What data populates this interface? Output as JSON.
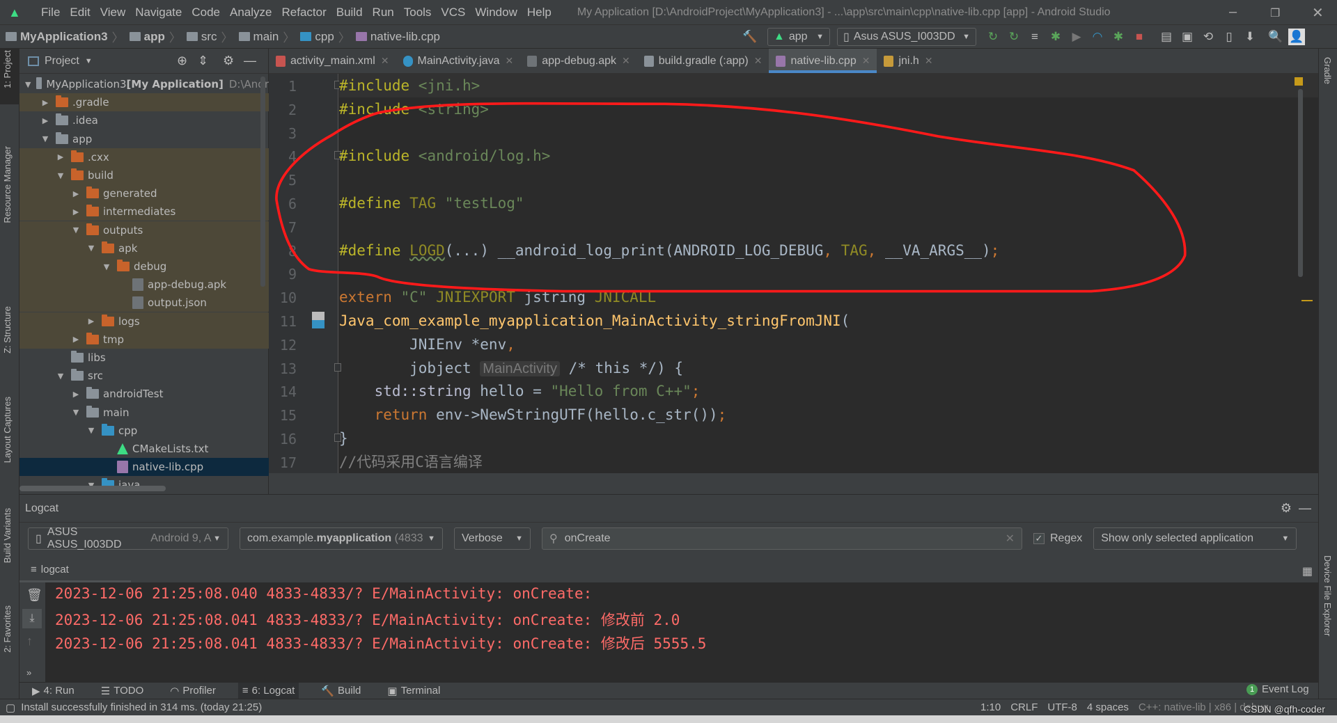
{
  "app": {
    "title": "My Application [D:\\AndroidProject\\MyApplication3] - ...\\app\\src\\main\\cpp\\native-lib.cpp [app] - Android Studio"
  },
  "menu": [
    "File",
    "Edit",
    "View",
    "Navigate",
    "Code",
    "Analyze",
    "Refactor",
    "Build",
    "Run",
    "Tools",
    "VCS",
    "Window",
    "Help"
  ],
  "breadcrumb": [
    "MyApplication3",
    "app",
    "src",
    "main",
    "cpp",
    "native-lib.cpp"
  ],
  "toolbar": {
    "run_config": "app",
    "device": "Asus ASUS_I003DD"
  },
  "left_strip": [
    "1: Project",
    "Resource Manager",
    "Z: Structure",
    "Layout Captures",
    "Build Variants",
    "2: Favorites"
  ],
  "right_strip": [
    "Gradle",
    "Device File Explorer"
  ],
  "project": {
    "header": "Project",
    "tree": [
      {
        "label": "MyApplication3",
        "extra": " [My Application]",
        "path": "D:\\Andr",
        "level": 0,
        "open": true,
        "icon": "module",
        "style": ""
      },
      {
        "label": ".gradle",
        "level": 1,
        "open": false,
        "icon": "folder-orange",
        "style": "excl"
      },
      {
        "label": ".idea",
        "level": 1,
        "open": false,
        "icon": "folder",
        "style": ""
      },
      {
        "label": "app",
        "level": 1,
        "open": true,
        "icon": "folder-module",
        "style": ""
      },
      {
        "label": ".cxx",
        "level": 2,
        "open": false,
        "icon": "folder-orange",
        "style": "excl"
      },
      {
        "label": "build",
        "level": 2,
        "open": true,
        "icon": "folder-orange",
        "style": "excl"
      },
      {
        "label": "generated",
        "level": 3,
        "open": false,
        "icon": "folder-orange",
        "style": "excl"
      },
      {
        "label": "intermediates",
        "level": 3,
        "open": false,
        "icon": "folder-orange",
        "style": "excl"
      },
      {
        "label": "outputs",
        "level": 3,
        "open": true,
        "icon": "folder-orange",
        "style": "excl"
      },
      {
        "label": "apk",
        "level": 4,
        "open": true,
        "icon": "folder-orange",
        "style": "excl"
      },
      {
        "label": "debug",
        "level": 5,
        "open": true,
        "icon": "folder-orange",
        "style": "excl"
      },
      {
        "label": "app-debug.apk",
        "level": 6,
        "icon": "apk-file",
        "style": "excl"
      },
      {
        "label": "output.json",
        "level": 6,
        "icon": "json-file",
        "style": "excl"
      },
      {
        "label": "logs",
        "level": 4,
        "open": false,
        "icon": "folder-orange",
        "style": "excl"
      },
      {
        "label": "tmp",
        "level": 3,
        "open": false,
        "icon": "folder-orange",
        "style": "excl"
      },
      {
        "label": "libs",
        "level": 2,
        "icon": "folder",
        "style": ""
      },
      {
        "label": "src",
        "level": 2,
        "open": true,
        "icon": "folder",
        "style": ""
      },
      {
        "label": "androidTest",
        "level": 3,
        "open": false,
        "icon": "folder",
        "style": ""
      },
      {
        "label": "main",
        "level": 3,
        "open": true,
        "icon": "folder",
        "style": ""
      },
      {
        "label": "cpp",
        "level": 4,
        "open": true,
        "icon": "folder-blue",
        "style": ""
      },
      {
        "label": "CMakeLists.txt",
        "level": 5,
        "icon": "cmake-file",
        "style": ""
      },
      {
        "label": "native-lib.cpp",
        "level": 5,
        "icon": "cpp-file",
        "style": "sel"
      },
      {
        "label": "java",
        "level": 4,
        "open": true,
        "icon": "folder-blue",
        "style": ""
      }
    ]
  },
  "tabs": [
    {
      "label": "activity_main.xml",
      "icon": "xml-file",
      "color": "#c75450"
    },
    {
      "label": "MainActivity.java",
      "icon": "java-class",
      "color": "#3592c4"
    },
    {
      "label": "app-debug.apk",
      "icon": "apk-file",
      "color": "#6e7377"
    },
    {
      "label": "build.gradle (:app)",
      "icon": "gradle",
      "color": "#8a9299"
    },
    {
      "label": "native-lib.cpp",
      "icon": "cpp-file",
      "color": "#9876aa",
      "active": true
    },
    {
      "label": "jni.h",
      "icon": "header-file",
      "color": "#c69a3a"
    }
  ],
  "code": [
    [
      [
        "#include",
        "pre"
      ],
      [
        " <jni.h>",
        "hdr"
      ]
    ],
    [
      [
        "#include",
        "pre"
      ],
      [
        " <string>",
        "hdr"
      ]
    ],
    [],
    [
      [
        "#include",
        "pre"
      ],
      [
        " <android/log.h>",
        "hdr"
      ]
    ],
    [],
    [
      [
        "#define",
        "pre"
      ],
      [
        " TAG ",
        "mac"
      ],
      [
        "\"testLog\"",
        "str"
      ]
    ],
    [],
    [
      [
        "#define",
        "pre"
      ],
      [
        " ",
        "txt"
      ],
      [
        "LOGD",
        "mac und"
      ],
      [
        "(...) __android_log_print(ANDROID_LOG_DEBUG",
        "txt"
      ],
      [
        ", ",
        "kw"
      ],
      [
        "TAG",
        "mac"
      ],
      [
        ", ",
        "kw"
      ],
      [
        "__VA_ARGS__)",
        "txt"
      ],
      [
        ";",
        "kw"
      ]
    ],
    [],
    [
      [
        "extern ",
        "kw"
      ],
      [
        "\"C\" ",
        "str"
      ],
      [
        "JNIEXPORT ",
        "mac"
      ],
      [
        "jstring ",
        "txt"
      ],
      [
        "JNICALL",
        "mac"
      ]
    ],
    [
      [
        "Java_com_example_myapplication_MainActivity_stringFromJNI",
        "fn"
      ],
      [
        "(",
        "txt"
      ]
    ],
    [
      [
        "        JNIEnv *env",
        "txt"
      ],
      [
        ",",
        "kw"
      ]
    ],
    [
      [
        "        jobject ",
        "txt"
      ],
      [
        "MainActivity",
        "hint"
      ],
      [
        " /* this */) {",
        "txt"
      ]
    ],
    [
      [
        "    ",
        "txt"
      ],
      [
        "std::string",
        "typ"
      ],
      [
        " hello = ",
        "txt"
      ],
      [
        "\"Hello from C++\"",
        "str"
      ],
      [
        ";",
        "kw"
      ]
    ],
    [
      [
        "    ",
        "txt"
      ],
      [
        "return ",
        "kw"
      ],
      [
        "env->NewStringUTF(hello.c_str())",
        "txt"
      ],
      [
        ";",
        "kw"
      ]
    ],
    [
      [
        "}",
        "txt"
      ]
    ],
    [
      [
        "//代码采用C语言编译",
        "com"
      ]
    ]
  ],
  "logcat": {
    "title": "Logcat",
    "device": "ASUS ASUS_I003DD",
    "device_extra": "Android 9, A",
    "process_prefix": "com.example.",
    "process_bold": "myapplication",
    "process_pid": "(4833",
    "level": "Verbose",
    "search": "onCreate",
    "regex_label": "Regex",
    "regex_checked": true,
    "filter": "Show only selected application",
    "tab": "logcat",
    "lines": [
      "2023-12-06 21:25:08.040 4833-4833/? E/MainActivity: onCreate: ",
      "2023-12-06 21:25:08.041 4833-4833/? E/MainActivity: onCreate: 修改前 2.0",
      "2023-12-06 21:25:08.041 4833-4833/? E/MainActivity: onCreate: 修改后 5555.5"
    ]
  },
  "bottom_tabs": [
    {
      "label": "4: Run",
      "icon": "run-icon"
    },
    {
      "label": "TODO",
      "icon": "todo-icon"
    },
    {
      "label": "Profiler",
      "icon": "profiler-icon"
    },
    {
      "label": "6: Logcat",
      "icon": "logcat-icon",
      "active": true
    },
    {
      "label": "Build",
      "icon": "build-icon"
    },
    {
      "label": "Terminal",
      "icon": "terminal-icon"
    }
  ],
  "event_log": {
    "count": "1",
    "label": "Event Log"
  },
  "status": {
    "message": "Install successfully finished in 314 ms. (today 21:25)",
    "position": "1:10",
    "line_sep": "CRLF",
    "encoding": "UTF-8",
    "indent": "4 spaces",
    "context": "C++: native-lib | x86 | debug",
    "watermark": "CSDN @qfh-coder"
  },
  "colors": {
    "annotation": "#ff1a1a",
    "accent": "#4a88c7",
    "log_error": "#ff6b68"
  }
}
